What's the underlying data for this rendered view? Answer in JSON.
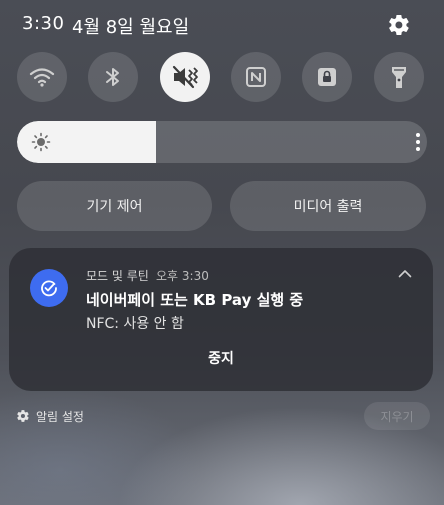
{
  "status_bar": {
    "time": "3:30",
    "date": "4월 8일 월요일",
    "settings_icon": "gear-icon"
  },
  "quick_toggles": [
    {
      "id": "wifi",
      "icon": "wifi-icon",
      "active": false
    },
    {
      "id": "bluetooth",
      "icon": "bluetooth-icon",
      "active": false
    },
    {
      "id": "sound",
      "icon": "sound-mute-icon",
      "active": true
    },
    {
      "id": "nfc",
      "icon": "nfc-icon",
      "active": false
    },
    {
      "id": "secure-folder",
      "icon": "lock-icon",
      "active": false
    },
    {
      "id": "flashlight",
      "icon": "flashlight-icon",
      "active": false
    }
  ],
  "brightness": {
    "level_percent": 34,
    "icon": "sun-icon",
    "more_icon": "more-vertical-icon"
  },
  "controls": {
    "device_control": "기기 제어",
    "media_output": "미디어 출력"
  },
  "notification": {
    "app_name": "모드 및 루틴",
    "time": "오후 3:30",
    "title": "네이버페이 또는 KB Pay 실행 중",
    "body": "NFC: 사용 안 함",
    "action": "중지",
    "icon": "check-circle-icon",
    "icon_color": "#3e6cf0"
  },
  "footer": {
    "settings_label": "알림 설정",
    "clear_label": "지우기"
  },
  "colors": {
    "accent": "#3e6cf0",
    "active_toggle_bg": "#f2f2f2",
    "toggle_bg": "rgba(255,255,255,0.13)"
  }
}
